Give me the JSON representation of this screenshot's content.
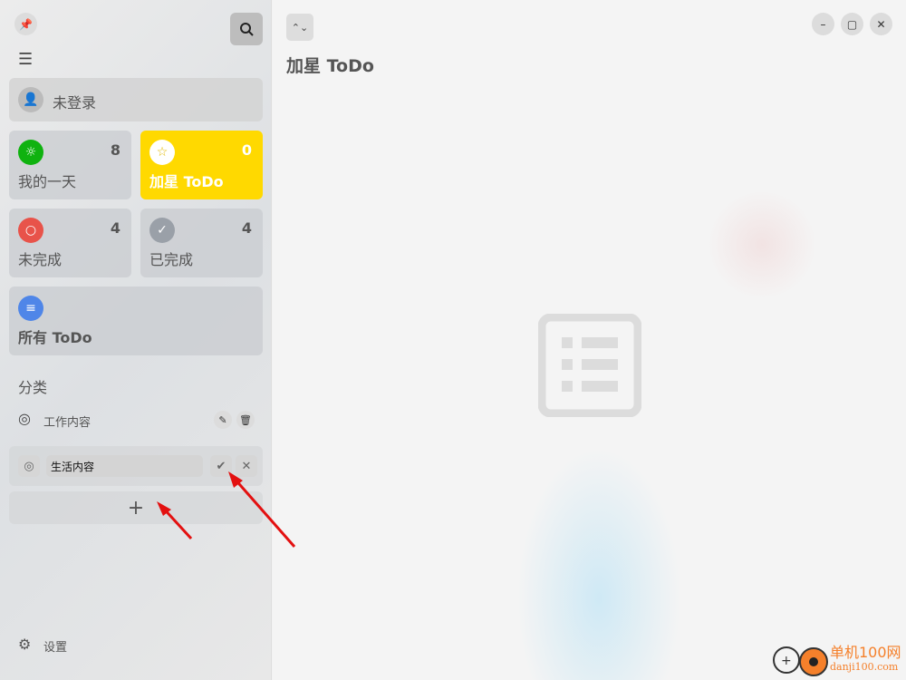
{
  "sidebar": {
    "user": "未登录",
    "cards": [
      {
        "label": "我的一天",
        "count": "8",
        "color": "#0fb20f",
        "icon": "sun-icon"
      },
      {
        "label": "加星 ToDo",
        "count": "0",
        "color": "#ffd900",
        "icon": "star-icon"
      },
      {
        "label": "未完成",
        "count": "4",
        "color": "#e8534a",
        "icon": "circle-icon"
      },
      {
        "label": "已完成",
        "count": "4",
        "color": "#9aa0a8",
        "icon": "check-circle-icon"
      },
      {
        "label": "所有 ToDo",
        "color": "#4f86e8",
        "icon": "list-icon"
      }
    ],
    "category_heading": "分类",
    "categories": [
      {
        "label": "工作内容"
      }
    ],
    "new_category_value": "生活内容",
    "settings": "设置"
  },
  "main": {
    "title": "加星 ToDo"
  },
  "watermark": {
    "text": "单机100网",
    "url_text": "danji100.com"
  }
}
